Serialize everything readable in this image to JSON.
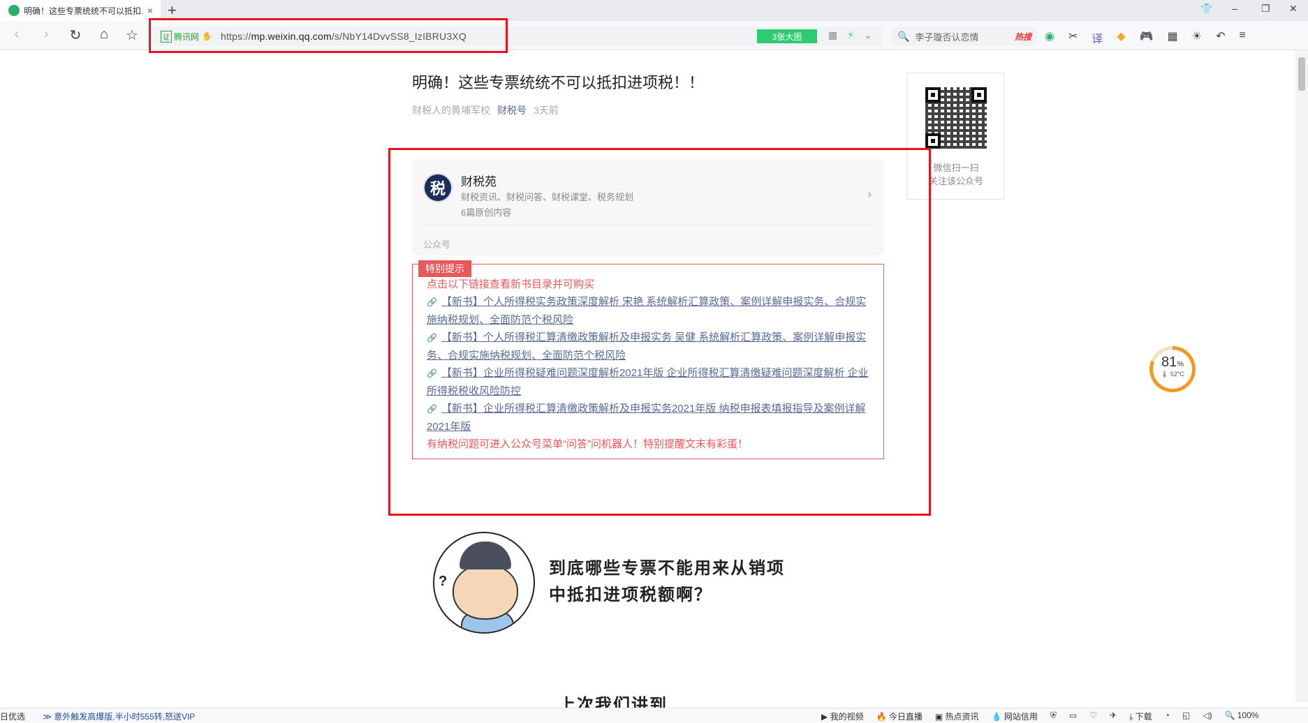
{
  "tab": {
    "title": "明确！这些专票统统不可以抵扣…",
    "close": "×",
    "new": "+"
  },
  "window": {
    "shirt": "👕",
    "min": "–",
    "restore": "❐",
    "close": "✕"
  },
  "nav": {
    "back": "‹",
    "forward": "›",
    "reload": "↻",
    "home": "⌂",
    "favorite": "☆"
  },
  "address": {
    "cert_badge": "证",
    "cert_label": "腾讯网",
    "url_prefix": "https://",
    "url_host": "mp.weixin.qq.com",
    "url_path": "/s/NbY14DvvSS8_IzIBRU3XQ",
    "big_pic": "3张大图",
    "icons": [
      "▦",
      "⚡",
      "⌄"
    ]
  },
  "search": {
    "icon": "🔍",
    "value": "李子璇否认恋情",
    "hot": "热搜"
  },
  "extensions": [
    "◉",
    "✂",
    "译",
    "◆",
    "🎮",
    "▦",
    "☀",
    "↶",
    "≡"
  ],
  "article": {
    "title": "明确！这些专票统统不可以抵扣进项税！！",
    "author": "财税人的黄埔军校",
    "account": "财税号",
    "time": "3天前"
  },
  "card": {
    "avatar": "税",
    "name": "财税苑",
    "desc": "财税资讯、财税问答、财税课堂、税务规划",
    "orig": "6篇原创内容",
    "chevron": "›",
    "type": "公众号"
  },
  "notice": {
    "tag": "特别提示",
    "intro": "点击以下链接查看新书目录并可购买",
    "chain_icon": "🔗",
    "links": [
      "【新书】个人所得税实务政策深度解析 宋艳 系统解析汇算政策、案例详解申报实务、合规实施纳税规划、全面防范个税风险",
      "【新书】个人所得税汇算清缴政策解析及申报实务 吴健 系统解析汇算政策、案例详解申报实务、合规实施纳税规划、全面防范个税风险",
      "【新书】企业所得税疑难问题深度解析2021年版 企业所得税汇算清缴疑难问题深度解析 企业所得税税收风险防控",
      "【新书】企业所得税汇算清缴政策解析及申报实务2021年版 纳税申报表填报指导及案例详解2021年版"
    ],
    "outro": "有纳税问题可进入公众号菜单“问答”问机器人！特别提醒文末有彩蛋！"
  },
  "qr": {
    "line1": "微信扫一扫",
    "line2": "关注该公众号"
  },
  "gauge": {
    "value": 81,
    "percent": "81",
    "unit": "%",
    "temp": "🌡 52°C"
  },
  "illustration": {
    "q": "?",
    "line1": "到底哪些专票不能用来从销项",
    "line2": "中抵扣进项税额啊？"
  },
  "next_title": "上次我们讲到",
  "status": {
    "left": "日优选",
    "news": "≫ 意外触发高爆版,半小时555转,怒送VIP",
    "items": [
      "▶ 我的视频",
      "🔥 今日直播",
      "▣ 热点资讯",
      "💧 网站信用",
      "⛨",
      "▭",
      "♡",
      "✈",
      "⤓ 下载",
      "◔",
      "◱",
      "◁)",
      "🔍 100%"
    ]
  },
  "colors": {
    "accent_red": "#e8141c",
    "link_blue": "#576b95",
    "notice_red": "#e8585a",
    "wechat_green": "#2aae67"
  }
}
